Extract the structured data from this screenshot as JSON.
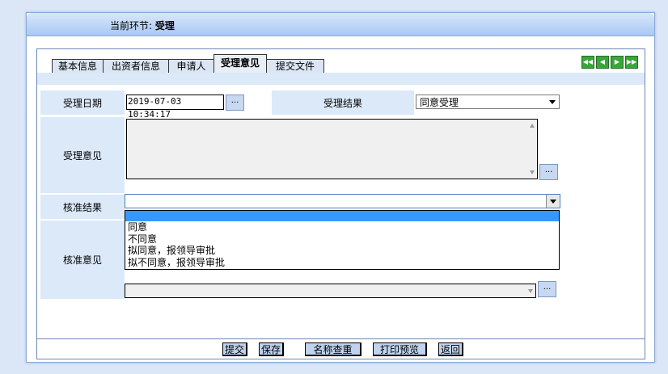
{
  "header": {
    "stage_label": "当前环节:",
    "stage_value": "受理"
  },
  "tabs": [
    {
      "label": "基本信息",
      "active": false
    },
    {
      "label": "出资者信息",
      "active": false
    },
    {
      "label": "申请人",
      "active": false
    },
    {
      "label": "受理意见",
      "active": true
    },
    {
      "label": "提交文件",
      "active": false
    }
  ],
  "nav_icons": [
    "first-icon",
    "prev-icon",
    "next-icon",
    "last-icon"
  ],
  "form": {
    "accept_date_label": "受理日期",
    "accept_date_value": "2019-07-03 10:34:17",
    "picker_label": "...",
    "accept_result_label": "受理结果",
    "accept_result_value": "同意受理",
    "accept_opinion_label": "受理意见",
    "accept_opinion_value": "",
    "approve_result_label": "核准结果",
    "approve_result_value": "",
    "approve_options": [
      "",
      "同意",
      "不同意",
      "拟同意，报领导审批",
      "拟不同意，报领导审批"
    ],
    "approve_opinion_label": "核准意见",
    "approve_opinion_value": ""
  },
  "footer_buttons": {
    "submit": "提交",
    "save": "保存",
    "name_check": "名称查重",
    "print_preview": "打印预览",
    "back": "返回"
  },
  "colors": {
    "label_bg": "#dbe9f9",
    "selected_option": "#3399ff",
    "nav_green": "#3aa63a"
  }
}
